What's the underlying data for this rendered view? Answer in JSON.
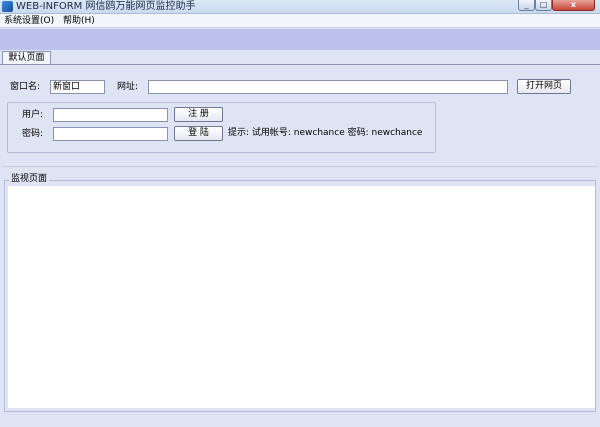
{
  "window": {
    "title": "WEB-INFORM 网信鸥万能网页监控助手",
    "min": "_",
    "max": "□",
    "close": "x"
  },
  "menu": {
    "items": [
      {
        "label": "系统设置(O)"
      },
      {
        "label": "帮助(H)"
      }
    ]
  },
  "tabs": [
    {
      "label": "默认页面",
      "active": true
    }
  ],
  "form": {
    "window_name_label": "窗口名:",
    "window_name_value": "新窗口",
    "url_label": "网址:",
    "url_value": "",
    "open_button": "打开网页"
  },
  "login": {
    "user_label": "用户:",
    "user_value": "",
    "password_label": "密码:",
    "password_value": "",
    "register_button": "注 册",
    "login_button": "登 陆",
    "hint": "提示: 试用帐号: newchance 密码: newchance"
  },
  "monitor": {
    "title": "监视页面"
  }
}
